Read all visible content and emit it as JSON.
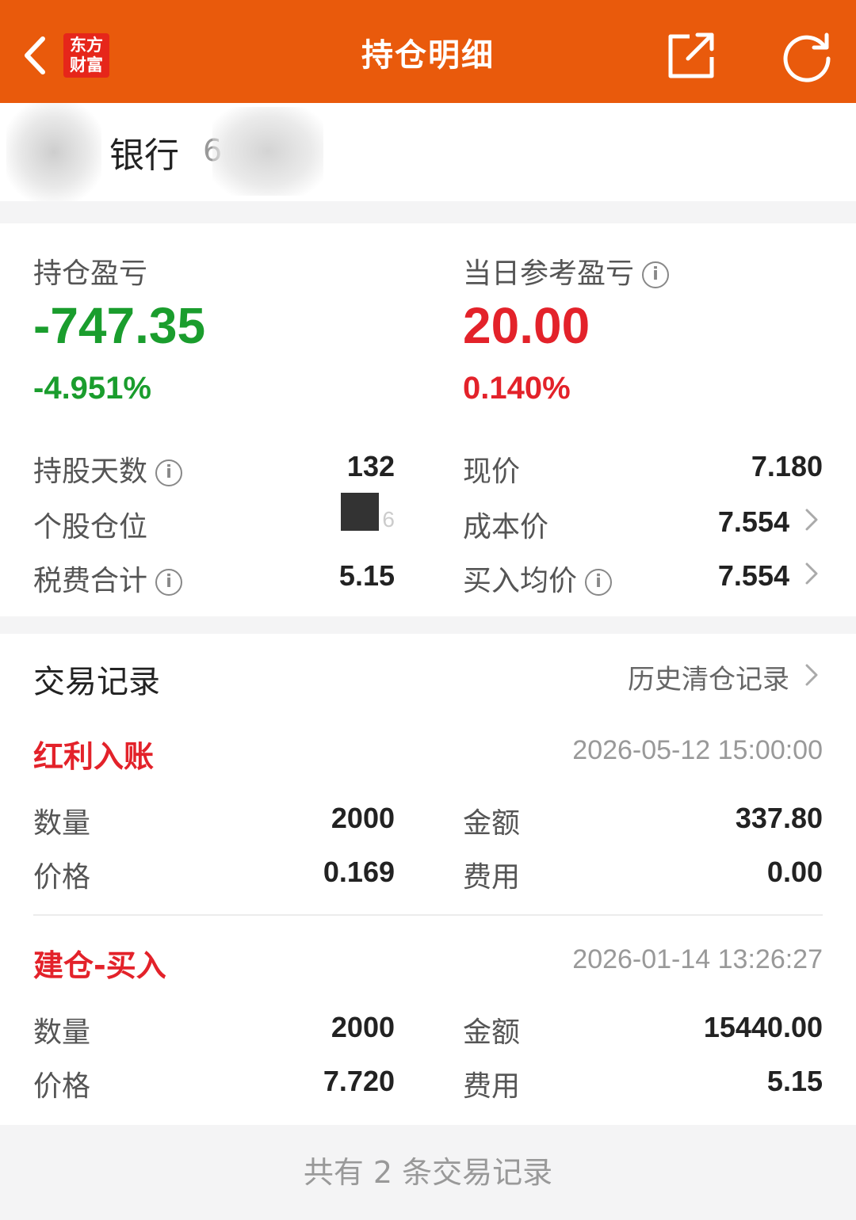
{
  "header": {
    "title": "持仓明细",
    "logo_line1": "东方",
    "logo_line2": "财富",
    "accent_color": "#e95a0c"
  },
  "stock": {
    "name": "银行",
    "code_fragment": "6"
  },
  "summary": {
    "position_pl_label": "持仓盈亏",
    "position_pl_value": "-747.35",
    "position_pl_pct": "-4.951%",
    "daily_pl_label": "当日参考盈亏",
    "daily_pl_value": "20.00",
    "daily_pl_pct": "0.140%",
    "rows": {
      "holding_days_label": "持股天数",
      "holding_days_value": "132",
      "position_ratio_label": "个股仓位",
      "position_ratio_value": "6",
      "tax_fee_label": "税费合计",
      "tax_fee_value": "5.15",
      "current_price_label": "现价",
      "current_price_value": "7.180",
      "cost_price_label": "成本价",
      "cost_price_value": "7.554",
      "avg_buy_label": "买入均价",
      "avg_buy_value": "7.554"
    }
  },
  "trades": {
    "section_title": "交易记录",
    "history_link": "历史清仓记录",
    "records": [
      {
        "type": "红利入账",
        "time": "2026-05-12 15:00:00",
        "qty_label": "数量",
        "qty": "2000",
        "amount_label": "金额",
        "amount": "337.80",
        "price_label": "价格",
        "price": "0.169",
        "fee_label": "费用",
        "fee": "0.00"
      },
      {
        "type": "建仓-买入",
        "time": "2026-01-14 13:26:27",
        "qty_label": "数量",
        "qty": "2000",
        "amount_label": "金额",
        "amount": "15440.00",
        "price_label": "价格",
        "price": "7.720",
        "fee_label": "费用",
        "fee": "5.15"
      }
    ]
  },
  "footer": {
    "count_text": "共有 2 条交易记录"
  }
}
